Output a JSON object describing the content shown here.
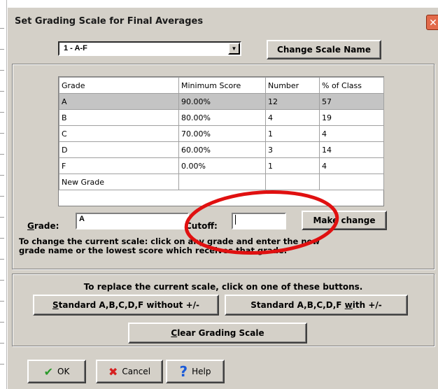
{
  "window": {
    "title": "Set Grading Scale for Final Averages",
    "close_glyph": "✕"
  },
  "scale_select": {
    "value": "1 - A-F"
  },
  "buttons": {
    "change_scale_name": "Change Scale Name",
    "make_change": "Make change",
    "std_without": {
      "mnemonic": "S",
      "rest": "tandard A,B,C,D,F without +/-"
    },
    "std_with": {
      "part1": "Standard A,B,C,D,F ",
      "mnemonic": "w",
      "part2": "ith +/-"
    },
    "clear": {
      "mnemonic": "C",
      "rest": "lear Grading Scale"
    },
    "ok": "OK",
    "cancel": "Cancel",
    "help": "Help"
  },
  "table": {
    "headers": [
      "Grade",
      "Minimum Score",
      "Number",
      "% of Class"
    ],
    "rows": [
      [
        "A",
        "90.00%",
        "12",
        "57"
      ],
      [
        "B",
        "80.00%",
        "4",
        "19"
      ],
      [
        "C",
        "70.00%",
        "1",
        "4"
      ],
      [
        "D",
        "60.00%",
        "3",
        "14"
      ],
      [
        "F",
        "0.00%",
        "1",
        "4"
      ],
      [
        "New Grade",
        "",
        "",
        ""
      ]
    ],
    "selected_row": 0
  },
  "edit": {
    "grade_label_mnemonic": "G",
    "grade_label_rest": "rade:",
    "grade_value": "A",
    "cutoff_label": "Cutoff:",
    "cutoff_value": ""
  },
  "info": {
    "line1": "To change the current scale: click on any grade and enter the new",
    "line2": "grade name or the lowest score which receives that grade."
  },
  "replace_text": "To replace the current scale, click on one of these buttons.",
  "icons": {
    "ok": "checkmark-icon",
    "cancel": "x-icon",
    "help": "question-icon"
  },
  "colors": {
    "dialog_bg": "#d4d0c8",
    "selected_row": "#c4c4c4",
    "annotation": "#e01010"
  }
}
